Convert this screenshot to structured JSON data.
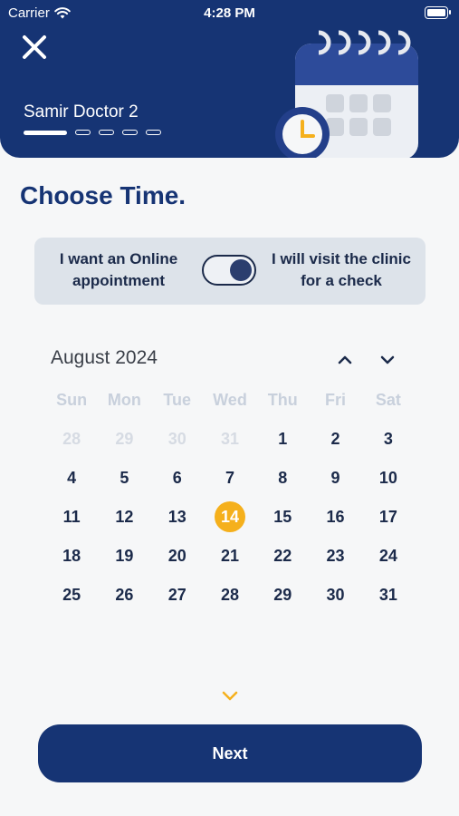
{
  "status_bar": {
    "carrier": "Carrier",
    "time": "4:28 PM"
  },
  "header": {
    "doctor_name": "Samir Doctor 2",
    "progress": {
      "steps": 5,
      "current": 1
    }
  },
  "page_title": "Choose Time.",
  "appointment_toggle": {
    "online_label": "I want an Online appointment",
    "visit_label": "I will visit the clinic for a check",
    "selected": "visit"
  },
  "calendar": {
    "month_label": "August 2024",
    "weekdays": [
      "Sun",
      "Mon",
      "Tue",
      "Wed",
      "Thu",
      "Fri",
      "Sat"
    ],
    "weeks": [
      [
        "28",
        "29",
        "30",
        "31",
        "1",
        "2",
        "3"
      ],
      [
        "4",
        "5",
        "6",
        "7",
        "8",
        "9",
        "10"
      ],
      [
        "11",
        "12",
        "13",
        "14",
        "15",
        "16",
        "17"
      ],
      [
        "18",
        "19",
        "20",
        "21",
        "22",
        "23",
        "24"
      ],
      [
        "25",
        "26",
        "27",
        "28",
        "29",
        "30",
        "31"
      ]
    ],
    "muted": [
      [
        0,
        0
      ],
      [
        0,
        1
      ],
      [
        0,
        2
      ],
      [
        0,
        3
      ]
    ],
    "selected_day": "14"
  },
  "next_button": "Next",
  "colors": {
    "primary": "#163474",
    "accent": "#f5b01c",
    "toggle_bg": "#dde3ea"
  }
}
